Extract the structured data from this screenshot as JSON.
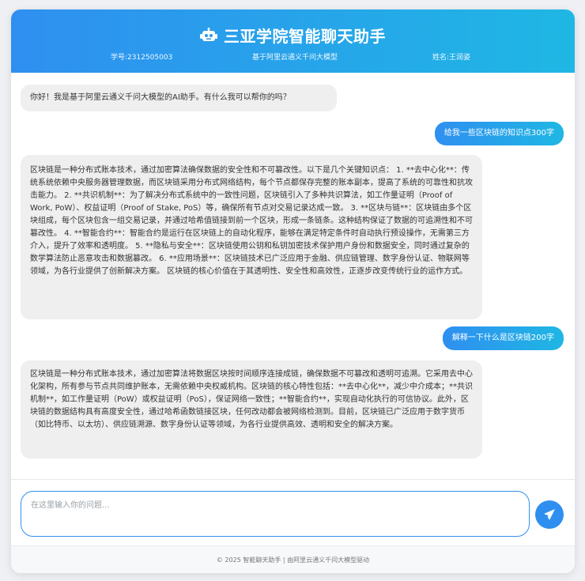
{
  "header": {
    "title": "三亚学院智能聊天助手",
    "student_id": "学号:2312505003",
    "model": "基于阿里云通义千问大模型",
    "name": "姓名:王润姿"
  },
  "messages": [
    {
      "role": "bot",
      "text": "你好！我是基于阿里云通义千问大模型的AI助手。有什么我可以帮你的吗？"
    },
    {
      "role": "user",
      "text": "给我一些区块链的知识点300字"
    },
    {
      "role": "bot",
      "text": "区块链是一种分布式账本技术，通过加密算法确保数据的安全性和不可篡改性。以下是几个关键知识点： 1. **去中心化**：传统系统依赖中央服务器管理数据，而区块链采用分布式网络结构，每个节点都保存完整的账本副本，提高了系统的可靠性和抗攻击能力。 2. **共识机制**：为了解决分布式系统中的一致性问题，区块链引入了多种共识算法，如工作量证明（Proof of Work, PoW）、权益证明（Proof of Stake, PoS）等，确保所有节点对交易记录达成一致。 3. **区块与链**：区块链由多个区块组成，每个区块包含一组交易记录，并通过哈希值链接到前一个区块，形成一条链条。这种结构保证了数据的可追溯性和不可篡改性。 4. **智能合约**：智能合约是运行在区块链上的自动化程序，能够在满足特定条件时自动执行预设操作，无需第三方介入，提升了效率和透明度。 5. **隐私与安全**：区块链使用公钥和私钥加密技术保护用户身份和数据安全，同时通过复杂的数学算法防止恶意攻击和数据篡改。 6. **应用场景**：区块链技术已广泛应用于金融、供应链管理、数字身份认证、物联网等领域，为各行业提供了创新解决方案。 区块链的核心价值在于其透明性、安全性和高效性，正逐步改变传统行业的运作方式。"
    },
    {
      "role": "user",
      "text": "解释一下什么是区块链200字"
    },
    {
      "role": "bot",
      "text": "区块链是一种分布式账本技术，通过加密算法将数据区块按时间顺序连接成链，确保数据不可篡改和透明可追溯。它采用去中心化架构，所有参与节点共同维护账本，无需依赖中央权威机构。区块链的核心特性包括：**去中心化**，减少中介成本；**共识机制**，如工作量证明（PoW）或权益证明（PoS），保证网络一致性；**智能合约**，实现自动化执行的可信协议。此外，区块链的数据结构具有高度安全性，通过哈希函数链接区块，任何改动都会被网络检测到。目前，区块链已广泛应用于数字货币（如比特币、以太坊）、供应链溯源、数字身份认证等领域，为各行业提供高效、透明和安全的解决方案。"
    }
  ],
  "input": {
    "placeholder": "在这里输入你的问题...",
    "value": ""
  },
  "footer": {
    "text": "© 2025 智能聊天助手 | 由阿里云通义千问大模型驱动"
  },
  "colors": {
    "accent": "#2f8ff0",
    "accent_end": "#1fb7e4",
    "bot_bubble": "#efefef"
  }
}
